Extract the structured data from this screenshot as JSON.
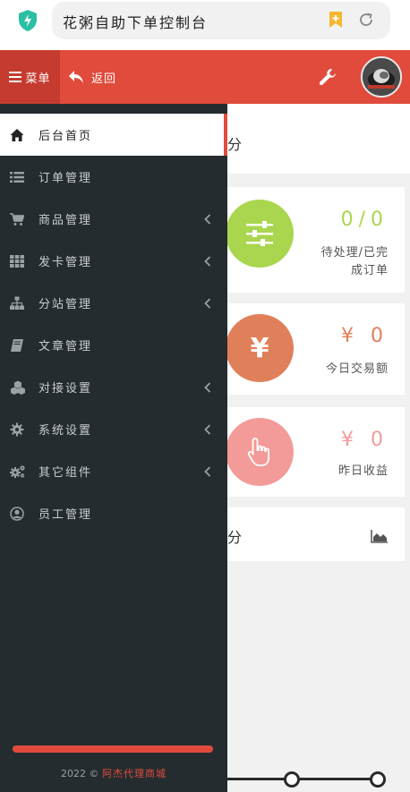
{
  "browser": {
    "url_title": "花粥自助下单控制台"
  },
  "header": {
    "menu_label": "菜单",
    "back_label": "返回"
  },
  "sidebar": {
    "items": [
      {
        "label": "后台首页",
        "icon": "home-icon",
        "active": true,
        "has_submenu": false
      },
      {
        "label": "订单管理",
        "icon": "list-icon",
        "active": false,
        "has_submenu": false
      },
      {
        "label": "商品管理",
        "icon": "cart-icon",
        "active": false,
        "has_submenu": true
      },
      {
        "label": "发卡管理",
        "icon": "grid-icon",
        "active": false,
        "has_submenu": true
      },
      {
        "label": "分站管理",
        "icon": "sitemap-icon",
        "active": false,
        "has_submenu": true
      },
      {
        "label": "文章管理",
        "icon": "book-icon",
        "active": false,
        "has_submenu": false
      },
      {
        "label": "对接设置",
        "icon": "cubes-icon",
        "active": false,
        "has_submenu": true
      },
      {
        "label": "系统设置",
        "icon": "gear-icon",
        "active": false,
        "has_submenu": true
      },
      {
        "label": "其它组件",
        "icon": "cogs-icon",
        "active": false,
        "has_submenu": true
      },
      {
        "label": "员工管理",
        "icon": "user-circle-icon",
        "active": false,
        "has_submenu": false
      }
    ],
    "footer_prefix": "2022 ©",
    "footer_brand": "阿杰代理商城"
  },
  "main": {
    "head_char": "分",
    "stats": [
      {
        "value": "0/0",
        "label_line1": "待处理/已完",
        "label_line2": "成订单",
        "color": "#a9d64e",
        "icon": "sliders-icon"
      },
      {
        "value": "¥ 0",
        "label_line1": "今日交易额",
        "label_line2": "",
        "color": "#e0805a",
        "icon": "yen-icon"
      },
      {
        "value": "¥ 0",
        "label_line1": "昨日收益",
        "label_line2": "",
        "color": "#f39b98",
        "icon": "hand-pointer-icon"
      }
    ],
    "chart_char": "分"
  },
  "colors": {
    "accent": "#e04b3c",
    "accent_dark": "#c53b2f",
    "drawer_bg": "#252c2f"
  }
}
